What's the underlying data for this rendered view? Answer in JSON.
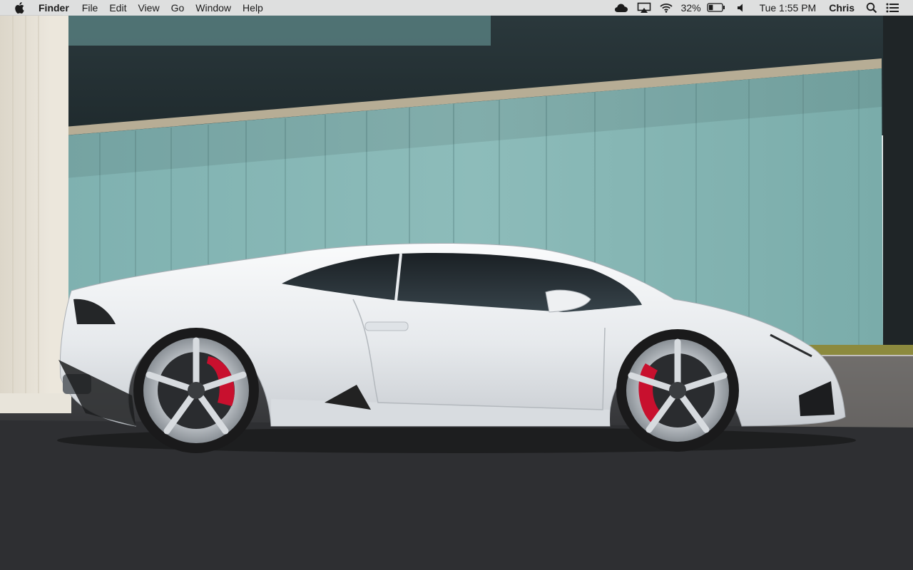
{
  "menubar": {
    "apple_menu": "apple-logo-icon",
    "app_name": "Finder",
    "menus": [
      "File",
      "Edit",
      "View",
      "Go",
      "Window",
      "Help"
    ],
    "status": {
      "icons": [
        "cloud-icon",
        "airplay-icon",
        "wifi-icon",
        "battery-icon",
        "volume-icon",
        "spotlight-search-icon",
        "notification-center-icon"
      ],
      "battery_percent": "32%",
      "battery_level": 0.32,
      "clock": "Tue 1:55 PM",
      "user": "Chris"
    }
  },
  "wallpaper": {
    "subject": "White sports car parked in front of a teal hangar wall"
  },
  "colors": {
    "menubar_bg": "#ececec",
    "hangar_teal": "#86b6b4",
    "asphalt": "#2f3033",
    "car_white": "#eef0f2",
    "caliper_red": "#c8102e"
  }
}
